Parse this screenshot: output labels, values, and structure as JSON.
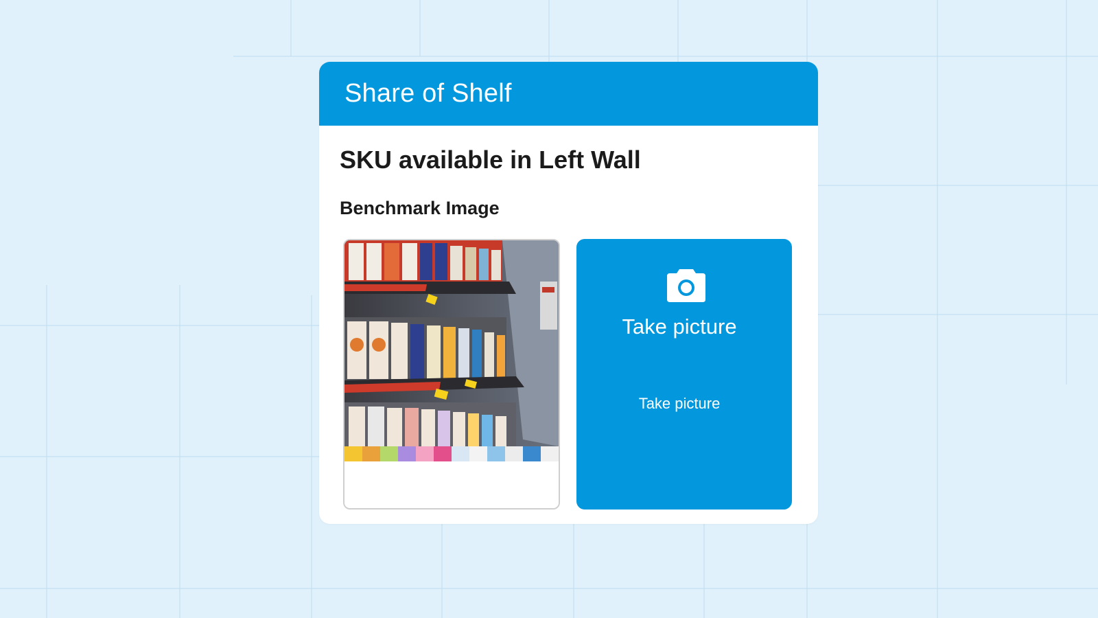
{
  "card": {
    "title": "Share of Shelf",
    "question": "SKU available in Left Wall",
    "benchmark_label": "Benchmark Image",
    "take_picture": {
      "label_main": "Take picture",
      "label_sub": "Take picture",
      "icon": "camera-icon"
    },
    "benchmark_image": "supermarket-shelf-photo"
  },
  "colors": {
    "background": "#e1f1fc",
    "accent": "#0398dd",
    "card": "#ffffff",
    "text": "#1b1b1b"
  }
}
